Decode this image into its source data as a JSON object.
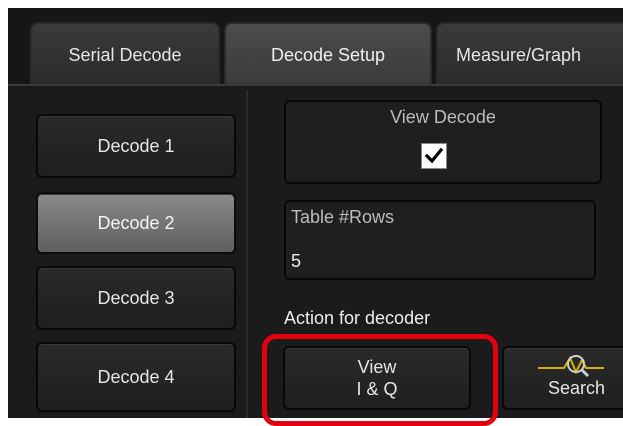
{
  "tabs": [
    "Serial Decode",
    "Decode Setup",
    "Measure/Graph"
  ],
  "decode_buttons": [
    "Decode 1",
    "Decode 2",
    "Decode 3",
    "Decode 4"
  ],
  "view_decode": {
    "label": "View Decode",
    "checked": true
  },
  "table_rows": {
    "label": "Table #Rows",
    "value": "5"
  },
  "action": {
    "label": "Action for decoder",
    "view_iq_line1": "View",
    "view_iq_line2": "I & Q",
    "search_label": "Search"
  },
  "icons": {
    "checkbox": "checkmark-icon",
    "search": "waveform-magnifier-icon"
  },
  "colors": {
    "highlight": "#e3000f",
    "selected": "#7a7a7a"
  }
}
